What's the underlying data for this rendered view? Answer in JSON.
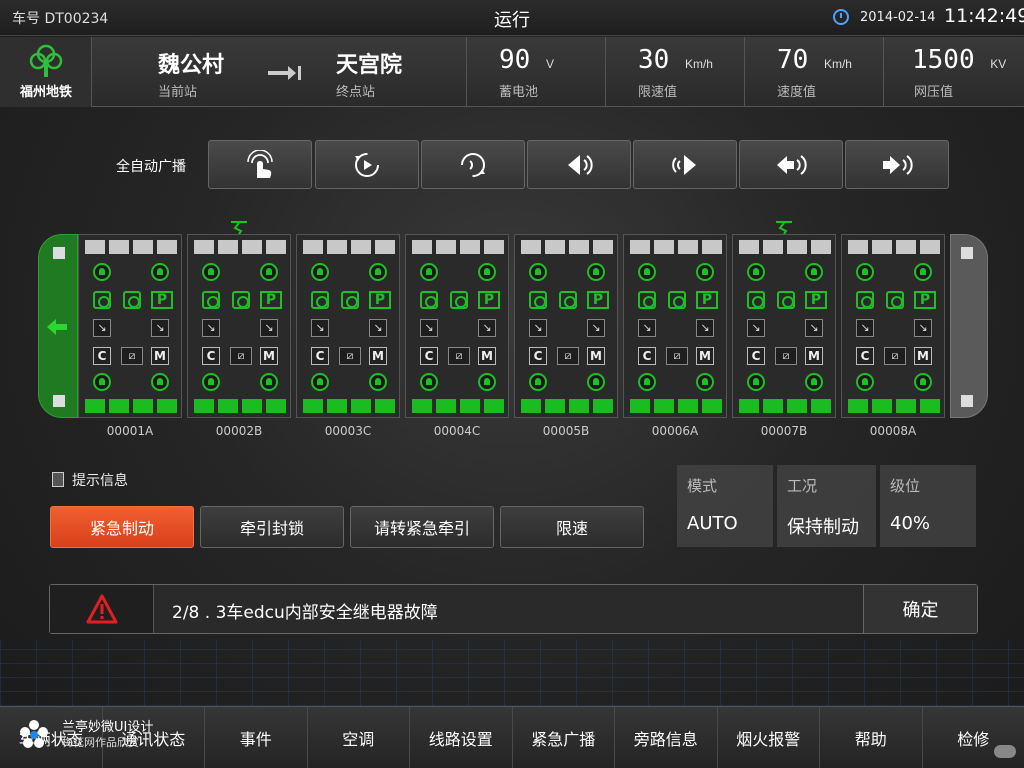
{
  "topbar": {
    "car_id": "车号 DT00234",
    "status": "运行",
    "date": "2014-02-14",
    "time": "11:42:49"
  },
  "logo": {
    "text": "福州地铁"
  },
  "stations": {
    "current_name": "魏公村",
    "current_label": "当前站",
    "terminal_name": "天宫院",
    "terminal_label": "终点站"
  },
  "metrics": [
    {
      "value": "90",
      "unit": "V",
      "label": "蓄电池"
    },
    {
      "value": "30",
      "unit": "Km/h",
      "label": "限速值"
    },
    {
      "value": "70",
      "unit": "Km/h",
      "label": "速度值"
    },
    {
      "value": "1500",
      "unit": "KV",
      "label": "网压值"
    }
  ],
  "broadcast": {
    "label": "全自动广播",
    "buttons": [
      "touch-icon",
      "rotate-left-icon",
      "rotate-right-icon",
      "speaker-left-icon",
      "speaker-both-icon",
      "arrow-left-sound-icon",
      "arrow-right-sound-icon"
    ]
  },
  "cars": [
    {
      "label": "00001A",
      "pantograph": false
    },
    {
      "label": "00002B",
      "pantograph": true
    },
    {
      "label": "00003C",
      "pantograph": false
    },
    {
      "label": "00004C",
      "pantograph": false
    },
    {
      "label": "00005B",
      "pantograph": false
    },
    {
      "label": "00006A",
      "pantograph": false
    },
    {
      "label": "00007B",
      "pantograph": true
    },
    {
      "label": "00008A",
      "pantograph": false
    }
  ],
  "car_icons": {
    "c": "C",
    "m": "M",
    "p": "P"
  },
  "hint": {
    "label": "提示信息"
  },
  "actions": [
    "紧急制动",
    "牵引封锁",
    "请转紧急牵引",
    "限速"
  ],
  "mode_panel": [
    {
      "key": "模式",
      "value": "AUTO"
    },
    {
      "key": "工况",
      "value": "保持制动"
    },
    {
      "key": "级位",
      "value": "40%"
    }
  ],
  "alarm": {
    "message": "2/8 . 3车edcu内部安全继电器故障",
    "confirm": "确定"
  },
  "nav": [
    "车辆状态",
    "通讯状态",
    "事件",
    "空调",
    "线路设置",
    "紧急广播",
    "旁路信息",
    "烟火报警",
    "帮助",
    "检修"
  ],
  "watermark": {
    "line1": "兰亭妙微UI设计",
    "line2": "梅花网作品欣赏"
  },
  "colors": {
    "accent_green": "#1fbf25",
    "alert_orange": "#e8501f",
    "alarm_red": "#e02020",
    "clock_blue": "#4aa3ff"
  }
}
